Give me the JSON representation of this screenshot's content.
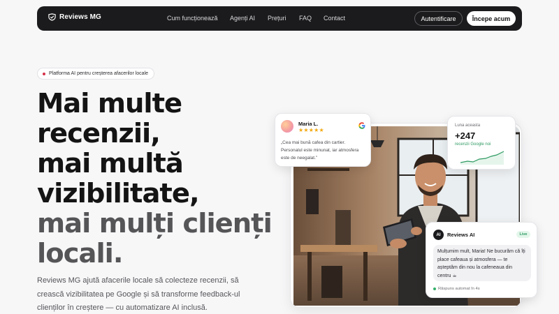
{
  "nav": {
    "brand": "Reviews MG",
    "links": [
      "Cum funcționează",
      "Agenți AI",
      "Prețuri",
      "FAQ",
      "Contact"
    ],
    "login_label": "Autentificare",
    "start_label": "Începe acum"
  },
  "hero": {
    "badge": "Platforma AI pentru creșterea afacerilor locale",
    "title_lines": [
      "Mai multe",
      "recenzii,",
      "mai multă",
      "vizibilitate,",
      "mai mulți clienți",
      "locali."
    ],
    "subtitle": "Reviews MG ajută afacerile locale să colecteze recenzii, să crească vizibilitatea pe Google și să transforme feedback-ul clienților în creștere — cu automatizare AI inclusă."
  },
  "review_card": {
    "name": "Maria L.",
    "stars": "★★★★★",
    "rating": 5,
    "text": "„Cea mai bună cafea din cartier. Personalul este minunat, iar atmosfera este de neegalat.”",
    "source_icon": "google-icon"
  },
  "stats_card": {
    "label": "Luna aceasta",
    "value": "+247",
    "sub": "recenzii Google noi"
  },
  "ai_card": {
    "avatar": "AI",
    "name": "Reviews AI",
    "status": "Live",
    "message": "Mulțumim mult, Maria! Ne bucurăm că îți place cafeaua și atmosfera — te așteptăm din nou la cafeneaua din centru ☕",
    "footer": "Răspuns automat în 4s"
  },
  "colors": {
    "dark": "#1b1b1d",
    "accent_red": "#d4304a",
    "star": "#f2a90f",
    "green": "#2e9a62"
  }
}
